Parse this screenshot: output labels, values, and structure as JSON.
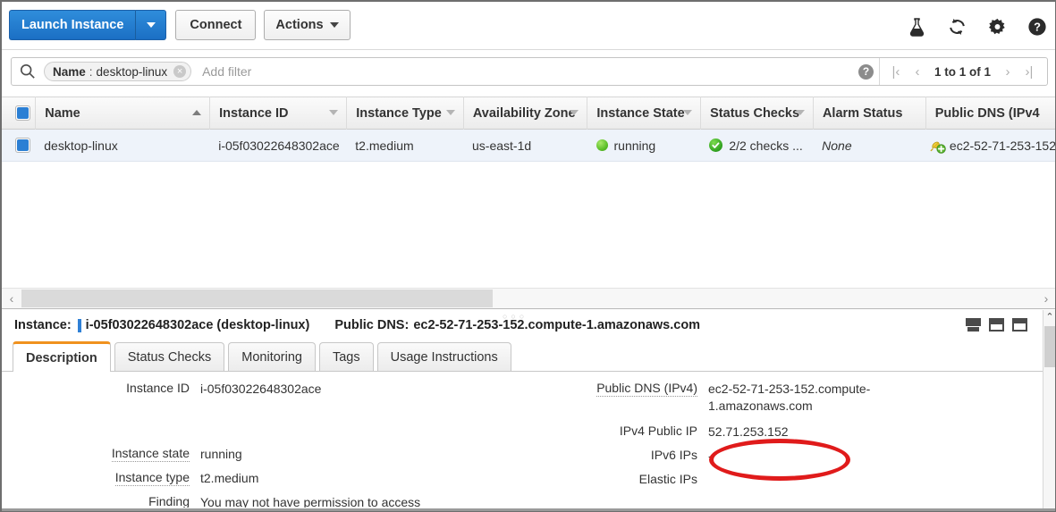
{
  "toolbar": {
    "launch_instance_label": "Launch Instance",
    "connect_label": "Connect",
    "actions_label": "Actions",
    "icons": [
      "flask-icon",
      "refresh-icon",
      "gear-icon",
      "help-icon"
    ]
  },
  "filter_bar": {
    "pill_key": "Name",
    "pill_separator": ":",
    "pill_value": "desktop-linux",
    "pill_remove": "×",
    "add_filter_placeholder": "Add filter",
    "help_glyph": "?",
    "pager": {
      "first": "|‹",
      "prev": "‹",
      "label": "1 to 1 of 1",
      "next": "›",
      "last": "›|"
    }
  },
  "table": {
    "columns": [
      {
        "label": "Name",
        "sort": "asc"
      },
      {
        "label": "Instance ID",
        "sort": "none"
      },
      {
        "label": "Instance Type",
        "sort": "none"
      },
      {
        "label": "Availability Zone",
        "sort": "none"
      },
      {
        "label": "Instance State",
        "sort": "none"
      },
      {
        "label": "Status Checks",
        "sort": "none"
      },
      {
        "label": "Alarm Status",
        "sort": null
      },
      {
        "label": "Public DNS (IPv4",
        "sort": null
      }
    ],
    "rows": [
      {
        "selected": true,
        "name": "desktop-linux",
        "instance_id": "i-05f03022648302ace",
        "instance_type": "t2.medium",
        "availability_zone": "us-east-1d",
        "instance_state": "running",
        "status_checks": "2/2 checks ...",
        "alarm_status": "None",
        "public_dns": "ec2-52-71-253-152"
      }
    ]
  },
  "details": {
    "instance_label": "Instance:",
    "instance_id_title": "i-05f03022648302ace (desktop-linux)",
    "public_dns_label": "Public DNS:",
    "public_dns_title": "ec2-52-71-253-152.compute-1.amazonaws.com",
    "tabs": [
      {
        "label": "Description",
        "active": true
      },
      {
        "label": "Status Checks",
        "active": false
      },
      {
        "label": "Monitoring",
        "active": false
      },
      {
        "label": "Tags",
        "active": false
      },
      {
        "label": "Usage Instructions",
        "active": false
      }
    ],
    "left_fields": [
      {
        "label": "Instance ID",
        "value": "i-05f03022648302ace",
        "dotted": false
      },
      {
        "label": "",
        "value": "",
        "dotted": false
      },
      {
        "label": "Instance state",
        "value": "running",
        "dotted": true
      },
      {
        "label": "Instance type",
        "value": "t2.medium",
        "dotted": true
      },
      {
        "label": "Finding",
        "value": "You may not have permission to access",
        "dotted": false
      }
    ],
    "right_fields": [
      {
        "label": "Public DNS (IPv4)",
        "value": "ec2-52-71-253-152.compute-1.amazonaws.com",
        "dotted": true
      },
      {
        "label": "IPv4 Public IP",
        "value": "52.71.253.152",
        "dotted": false
      },
      {
        "label": "IPv6 IPs",
        "value": "-",
        "dotted": false
      },
      {
        "label": "Elastic IPs",
        "value": "",
        "dotted": false
      }
    ],
    "panel_icons": [
      "panel-maximize-icon",
      "panel-split-icon",
      "panel-minimize-icon"
    ],
    "scroll_up_glyph": "⌃"
  },
  "colors": {
    "primary_button": "#1b6fc4",
    "active_tab_accent": "#f0921e",
    "running_status": "#5cbf2a",
    "checks_ok": "#2ea01f",
    "annotation": "#e01b1b",
    "selected_row": "#eef3fa"
  }
}
